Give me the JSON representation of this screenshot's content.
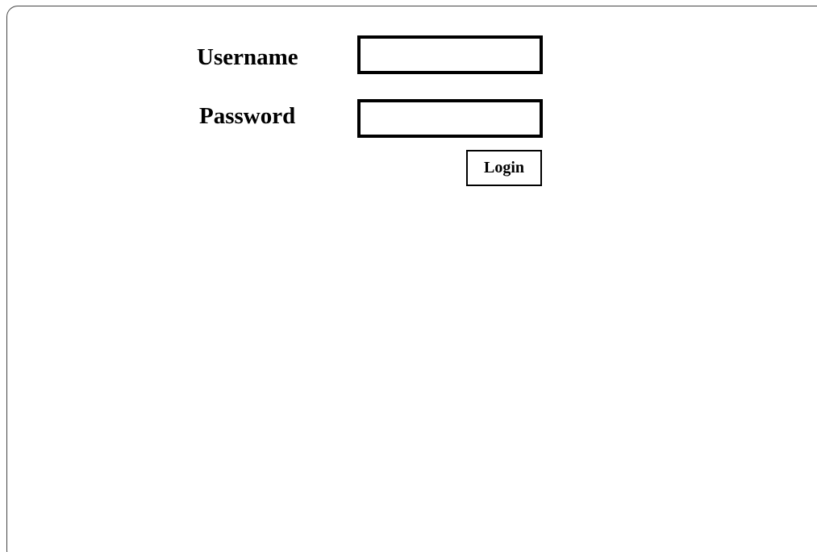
{
  "login_form": {
    "username_label": "Username",
    "username_value": "",
    "password_label": "Password",
    "password_value": "",
    "login_label": "Login"
  }
}
